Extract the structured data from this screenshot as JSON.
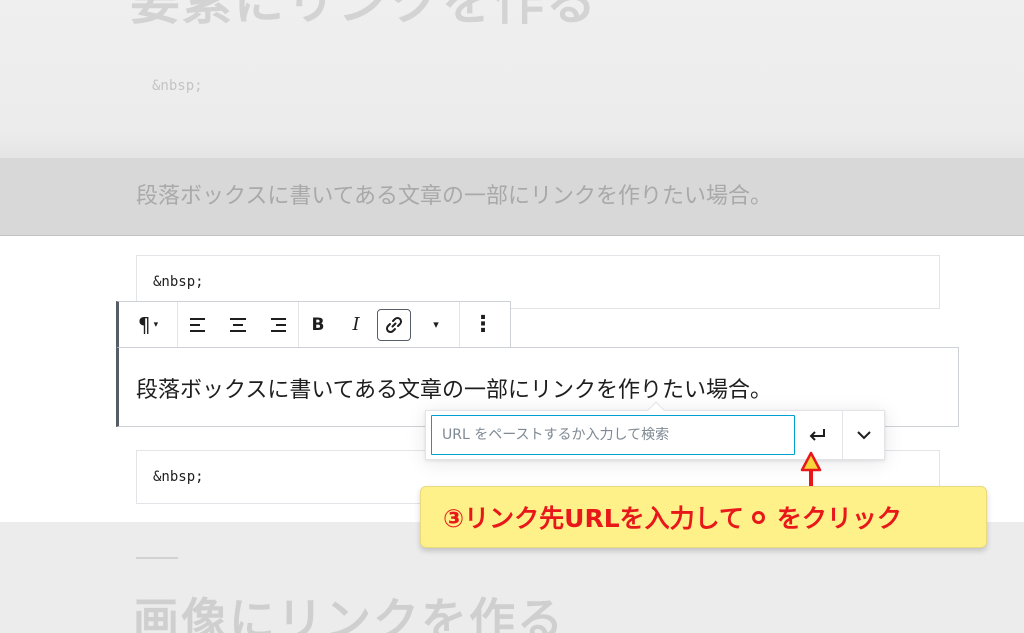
{
  "background": {
    "top_heading": "要素にリンクを作る",
    "top_nbsp": "&nbsp;",
    "dimmed_paragraph": "段落ボックスに書いてある文章の一部にリンクを作りたい場合。",
    "bottom_heading": "画像にリンクを作る"
  },
  "blocks": {
    "nbsp_above": "&nbsp;",
    "nbsp_below": "&nbsp;",
    "paragraph": "段落ボックスに書いてある文章の一部にリンクを作りたい場合。"
  },
  "toolbar": {
    "paragraph_icon": "¶",
    "caret": "▾",
    "bold": "B",
    "italic": "I",
    "more": "▾",
    "kebab": "⋮",
    "icons": [
      "paragraph-icon",
      "align-left-icon",
      "align-center-icon",
      "align-right-icon",
      "bold-icon",
      "italic-icon",
      "link-icon",
      "chevron-down-icon",
      "more-options-icon"
    ],
    "active": "link"
  },
  "link_popover": {
    "url_value": "",
    "url_placeholder": "URL をペーストするか入力して検索",
    "submit_icon": "enter-icon",
    "expand_icon": "chevron-down-icon"
  },
  "annotation": {
    "text_before": "③リンク先URLを入力して",
    "text_after": "をクリック",
    "color": "#e8171a",
    "background": "#fef18a"
  },
  "colors": {
    "input_focus": "#00a0d2",
    "block_border": "#555d66"
  }
}
